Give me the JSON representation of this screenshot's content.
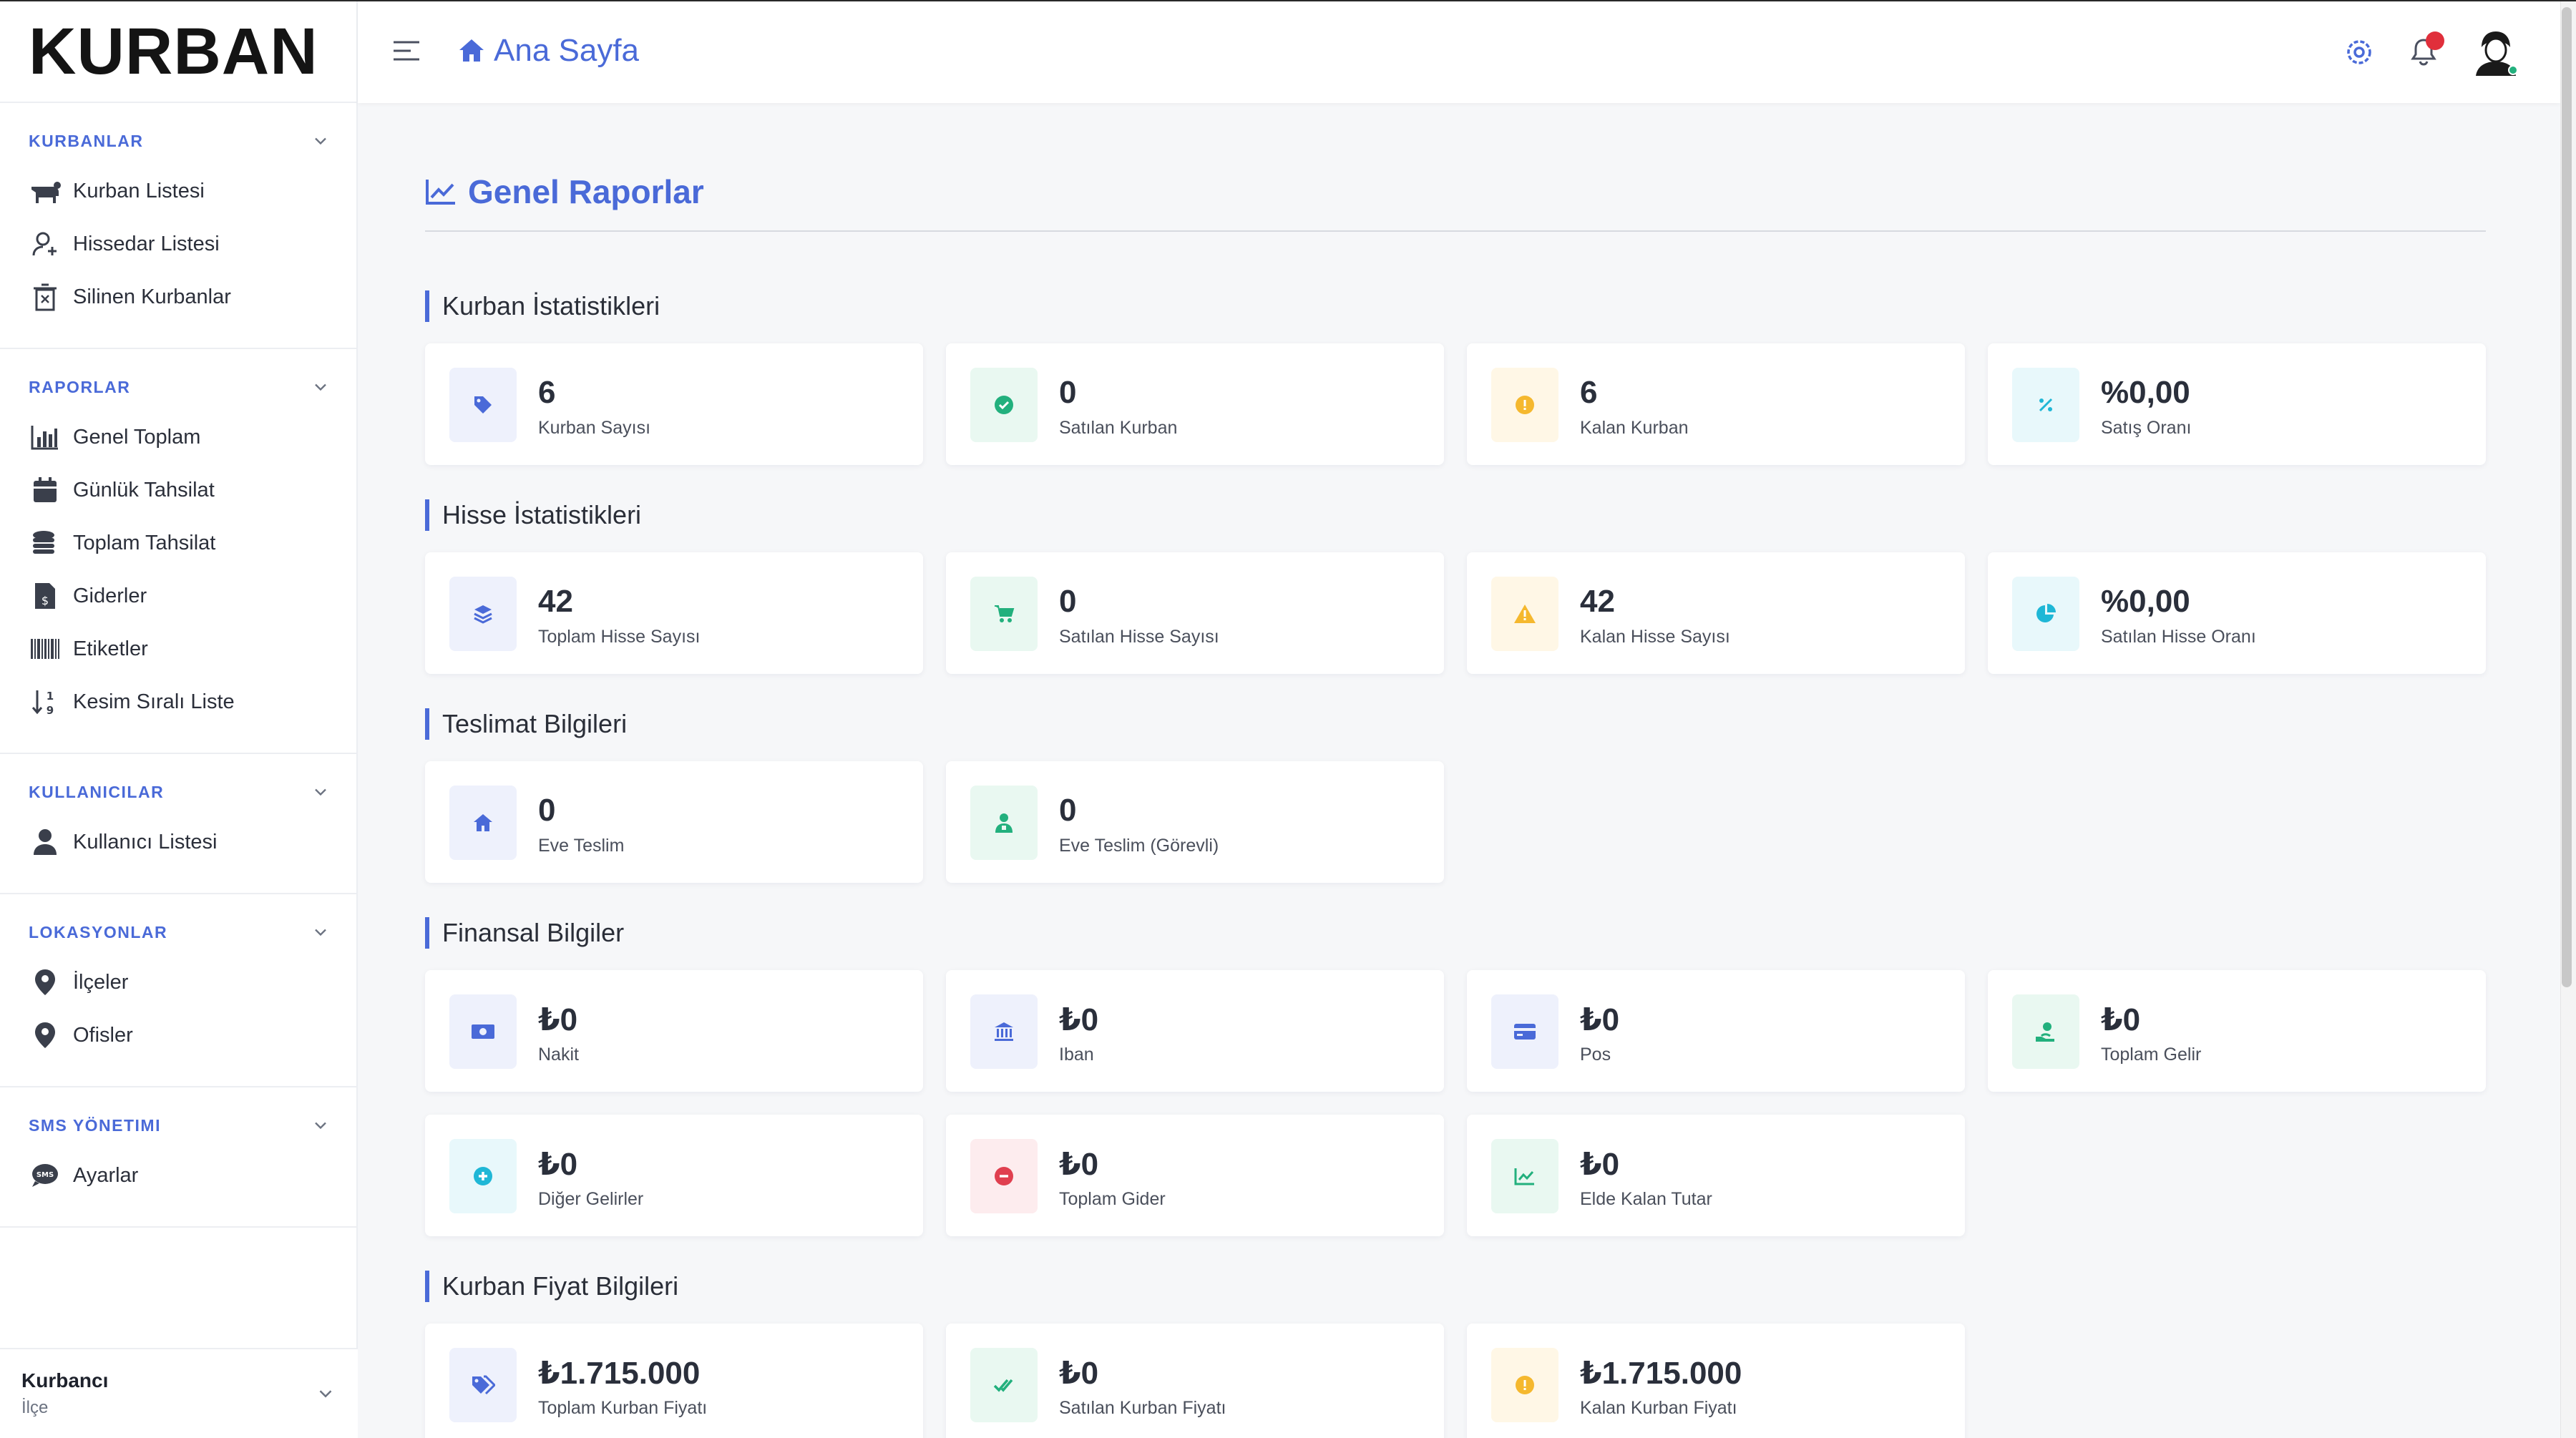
{
  "brand": "KURBAN",
  "sidebar": {
    "sections": [
      {
        "title": "KURBANLAR",
        "items": [
          {
            "label": "Kurban Listesi",
            "icon": "cow-icon"
          },
          {
            "label": "Hissedar Listesi",
            "icon": "user-add-icon"
          },
          {
            "label": "Silinen Kurbanlar",
            "icon": "trash-icon"
          }
        ]
      },
      {
        "title": "RAPORLAR",
        "items": [
          {
            "label": "Genel Toplam",
            "icon": "bar-chart-icon"
          },
          {
            "label": "Günlük Tahsilat",
            "icon": "calendar-icon"
          },
          {
            "label": "Toplam Tahsilat",
            "icon": "coins-icon"
          },
          {
            "label": "Giderler",
            "icon": "invoice-icon"
          },
          {
            "label": "Etiketler",
            "icon": "barcode-icon"
          },
          {
            "label": "Kesim Sıralı Liste",
            "icon": "sort-icon"
          }
        ]
      },
      {
        "title": "KULLANICILAR",
        "items": [
          {
            "label": "Kullanıcı Listesi",
            "icon": "user-icon"
          }
        ]
      },
      {
        "title": "LOKASYONLAR",
        "items": [
          {
            "label": "İlçeler",
            "icon": "map-pin-icon"
          },
          {
            "label": "Ofisler",
            "icon": "map-pin-icon"
          }
        ]
      },
      {
        "title": "SMS YÖNETIMI",
        "items": [
          {
            "label": "Ayarlar",
            "icon": "sms-icon"
          }
        ]
      }
    ],
    "user": {
      "name": "Kurbancı",
      "role": "İlçe"
    }
  },
  "header": {
    "breadcrumb": "Ana Sayfa",
    "icons": [
      "menu-icon",
      "home-icon",
      "settings-icon",
      "bell-icon",
      "avatar"
    ]
  },
  "main": {
    "title": "Genel Raporlar",
    "sections": [
      {
        "title": "Kurban İstatistikleri",
        "cards": [
          {
            "value": "6",
            "label": "Kurban Sayısı",
            "icon": "tag-icon",
            "color": "#4a6ad8",
            "bg": "#eef1fc"
          },
          {
            "value": "0",
            "label": "Satılan Kurban",
            "icon": "check-circle-icon",
            "color": "#22b07d",
            "bg": "#e9f8f1"
          },
          {
            "value": "6",
            "label": "Kalan Kurban",
            "icon": "exclamation-icon",
            "color": "#f5b82e",
            "bg": "#fff7e6"
          },
          {
            "value": "%0,00",
            "label": "Satış Oranı",
            "icon": "percent-icon",
            "color": "#1fb7d6",
            "bg": "#e8f8fb"
          }
        ]
      },
      {
        "title": "Hisse İstatistikleri",
        "cards": [
          {
            "value": "42",
            "label": "Toplam Hisse Sayısı",
            "icon": "layers-icon",
            "color": "#4a6ad8",
            "bg": "#eef1fc"
          },
          {
            "value": "0",
            "label": "Satılan Hisse Sayısı",
            "icon": "cart-icon",
            "color": "#22b07d",
            "bg": "#e9f8f1"
          },
          {
            "value": "42",
            "label": "Kalan Hisse Sayısı",
            "icon": "warning-icon",
            "color": "#f5b82e",
            "bg": "#fff7e6"
          },
          {
            "value": "%0,00",
            "label": "Satılan Hisse Oranı",
            "icon": "pie-chart-icon",
            "color": "#1fb7d6",
            "bg": "#e8f8fb"
          }
        ]
      },
      {
        "title": "Teslimat Bilgileri",
        "cards": [
          {
            "value": "0",
            "label": "Eve Teslim",
            "icon": "home-icon",
            "color": "#4a6ad8",
            "bg": "#eef1fc"
          },
          {
            "value": "0",
            "label": "Eve Teslim (Görevli)",
            "icon": "courier-icon",
            "color": "#22b07d",
            "bg": "#e9f8f1"
          }
        ]
      },
      {
        "title": "Finansal Bilgiler",
        "cards": [
          {
            "value": "₺0",
            "label": "Nakit",
            "icon": "cash-icon",
            "color": "#4a6ad8",
            "bg": "#eef1fc"
          },
          {
            "value": "₺0",
            "label": "Iban",
            "icon": "bank-icon",
            "color": "#4a6ad8",
            "bg": "#eef1fc"
          },
          {
            "value": "₺0",
            "label": "Pos",
            "icon": "credit-card-icon",
            "color": "#4a6ad8",
            "bg": "#eef1fc"
          },
          {
            "value": "₺0",
            "label": "Toplam Gelir",
            "icon": "hand-money-icon",
            "color": "#22b07d",
            "bg": "#e9f8f1"
          },
          {
            "value": "₺0",
            "label": "Diğer Gelirler",
            "icon": "plus-circle-icon",
            "color": "#1fb7d6",
            "bg": "#e8f8fb"
          },
          {
            "value": "₺0",
            "label": "Toplam Gider",
            "icon": "minus-circle-icon",
            "color": "#e03f4f",
            "bg": "#fdecee"
          },
          {
            "value": "₺0",
            "label": "Elde Kalan Tutar",
            "icon": "trend-icon",
            "color": "#22b07d",
            "bg": "#e9f8f1"
          }
        ]
      },
      {
        "title": "Kurban Fiyat Bilgileri",
        "cards": [
          {
            "value": "₺1.715.000",
            "label": "Toplam Kurban Fiyatı",
            "icon": "tags-icon",
            "color": "#4a6ad8",
            "bg": "#eef1fc"
          },
          {
            "value": "₺0",
            "label": "Satılan Kurban Fiyatı",
            "icon": "double-check-icon",
            "color": "#22b07d",
            "bg": "#e9f8f1"
          },
          {
            "value": "₺1.715.000",
            "label": "Kalan Kurban Fiyatı",
            "icon": "exclamation-icon",
            "color": "#f5b82e",
            "bg": "#fff7e6"
          }
        ]
      }
    ]
  },
  "colors": {
    "accent": "#4a6ad8",
    "success": "#22b07d",
    "warning": "#f5b82e",
    "info": "#1fb7d6",
    "danger": "#e03f4f"
  }
}
